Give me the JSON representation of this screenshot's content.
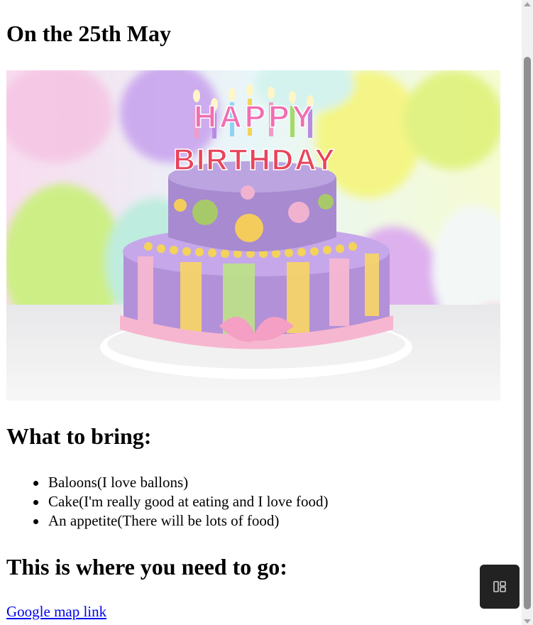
{
  "page": {
    "date_heading": "On the 25th May",
    "image": {
      "banner_line1": "HAPPY",
      "banner_line2": "BIRTHDAY",
      "alt": "birthday-cake-image"
    },
    "bring_heading": "What to bring:",
    "bring_items": [
      "Baloons(I love ballons)",
      "Cake(I'm really good at eating and I love food)",
      "An appetite(There will be lots of food)"
    ],
    "where_heading": "This is where you need to go:",
    "map_link": "Google map link"
  },
  "colors": {
    "link": "#0000ee",
    "widget_bg": "#222222",
    "scroll_thumb": "#8f8f8f"
  },
  "icons": {
    "widget": "layout-panels-icon"
  }
}
